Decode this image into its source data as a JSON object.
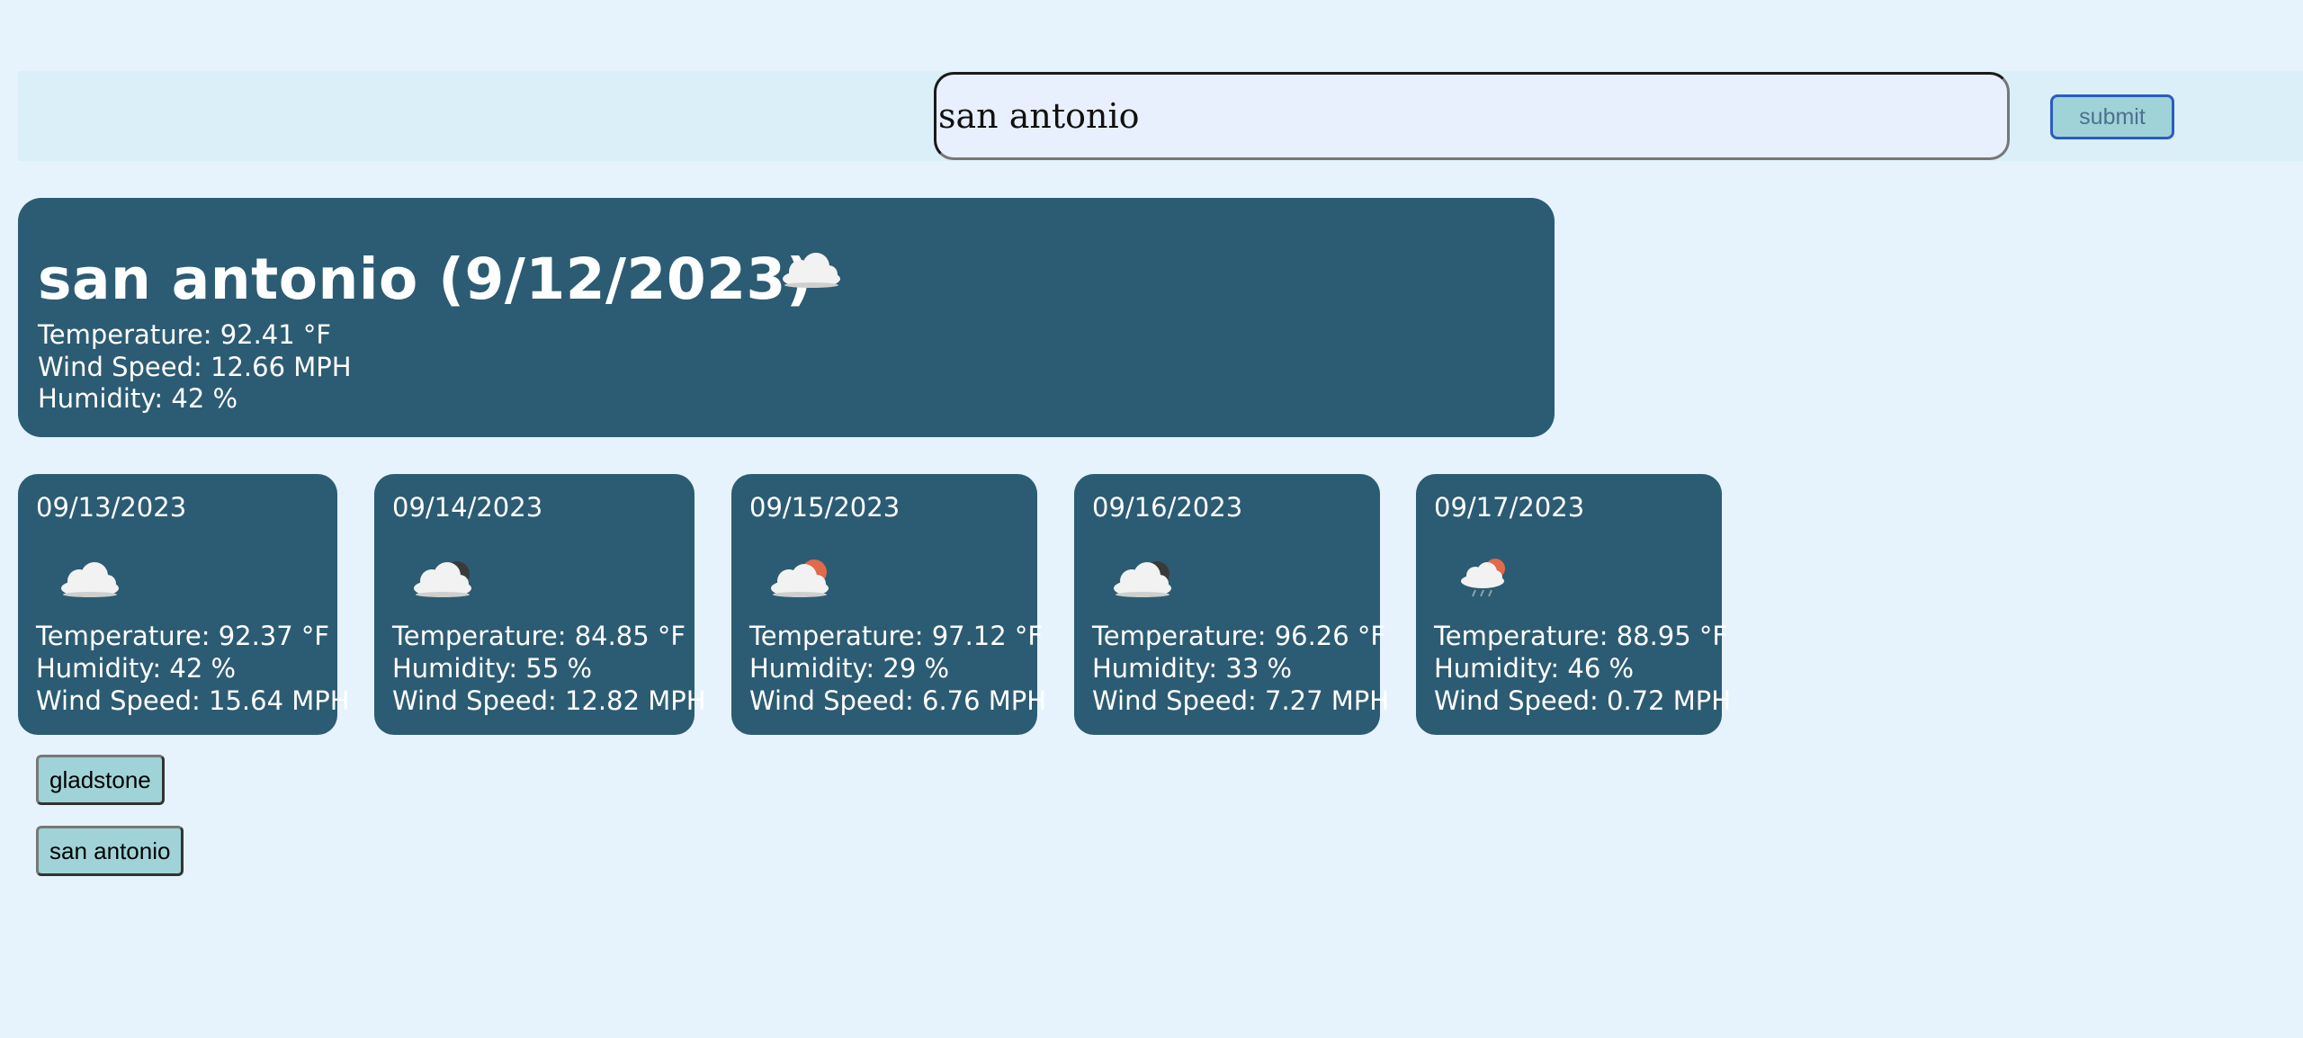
{
  "search": {
    "value": "san antonio",
    "submit_label": "submit"
  },
  "current": {
    "title": "san antonio (9/12/2023)",
    "icon": "cloud-icon",
    "temperature": "Temperature: 92.41 °F",
    "wind": "Wind Speed: 12.66 MPH",
    "humidity": "Humidity: 42 %"
  },
  "forecast": [
    {
      "date": "09/13/2023",
      "icon": "cloud-icon",
      "temperature": "Temperature: 92.37 °F",
      "humidity": "Humidity: 42 %",
      "wind": "Wind Speed: 15.64 MPH"
    },
    {
      "date": "09/14/2023",
      "icon": "cloud-night-icon",
      "temperature": "Temperature: 84.85 °F",
      "humidity": "Humidity: 55 %",
      "wind": "Wind Speed: 12.82 MPH"
    },
    {
      "date": "09/15/2023",
      "icon": "cloud-sun-icon",
      "temperature": "Temperature: 97.12 °F",
      "humidity": "Humidity: 29 %",
      "wind": "Wind Speed: 6.76 MPH"
    },
    {
      "date": "09/16/2023",
      "icon": "cloud-night-icon",
      "temperature": "Temperature: 96.26 °F",
      "humidity": "Humidity: 33 %",
      "wind": "Wind Speed: 7.27 MPH"
    },
    {
      "date": "09/17/2023",
      "icon": "rain-sun-icon",
      "temperature": "Temperature: 88.95 °F",
      "humidity": "Humidity: 46 %",
      "wind": "Wind Speed: 0.72 MPH"
    }
  ],
  "history": [
    {
      "label": "gladstone"
    },
    {
      "label": "san antonio"
    }
  ],
  "colors": {
    "page_bg": "#e6f3fc",
    "card_bg": "#2c5c73",
    "button_bg": "#9fd3d8",
    "sun": "#e06a4a",
    "moon": "#3a3a3a"
  }
}
